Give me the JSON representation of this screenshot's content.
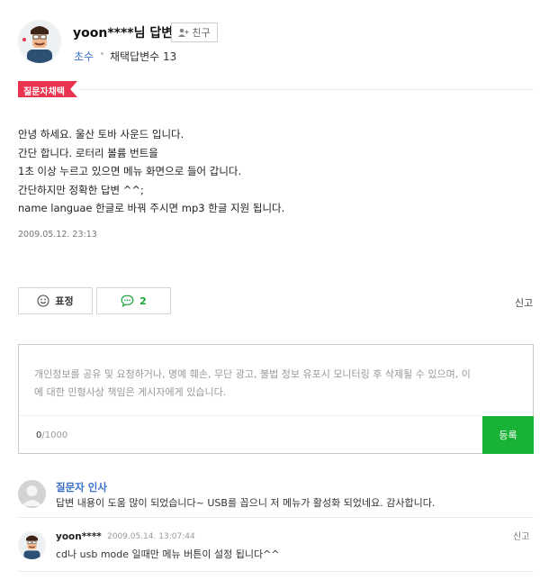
{
  "answerer": {
    "username": "yoon****님 답변",
    "friend_label": "친구",
    "grade": "초수",
    "selected_count": "채택답변수 13"
  },
  "badge_label": "질문자채택",
  "answer": {
    "lines": [
      "안녕 하세요. 울산 토바 사운드 입니다.",
      "간단 합니다. 로터리 볼륨 번트을",
      "1초 이상 누르고 있으면 메뉴 화면으로 들어 갑니다.",
      "간단하지만 정확한 답변 ^^;",
      "name languae 한글로 바꿔 주시면 mp3 한글 지원 됩니다."
    ],
    "date": "2009.05.12. 23:13"
  },
  "actions": {
    "emote_label": "표정",
    "comment_count": "2",
    "report_label": "신고"
  },
  "comment_form": {
    "placeholder_lines": [
      "개인정보를 공유 및 요청하거나, 명예 훼손, 무단 광고, 불법 정보 유포시 모니터링 후 삭제될 수 있으며, 이",
      "에 대한 민형사상 책임은 게시자에게 있습니다."
    ],
    "count_current": "0",
    "count_max": "/1000",
    "submit_label": "등록"
  },
  "thanks": {
    "title": "질문자 인사",
    "text": "답변 내용이 도움 많이 되었습니다~ USB를 꼽으니 저 메뉴가 활성화 되었네요. 감사합니다."
  },
  "comment": {
    "user": "yoon****",
    "date": "2009.05.14. 13:07:44",
    "report_label": "신고",
    "text": "cd나 usb mode 일때만 메뉴 버튼이 설정 됩니다^^"
  },
  "colors": {
    "accent_blue": "#3a6fc7",
    "badge_red": "#e8344e",
    "action_green": "#18b335"
  }
}
